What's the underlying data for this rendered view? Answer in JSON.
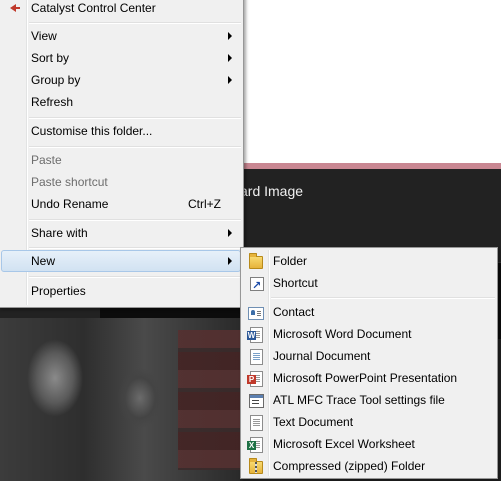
{
  "background": {
    "caption": "ard Image"
  },
  "context_menu": {
    "items": {
      "catalyst": "Catalyst Control Center",
      "view": "View",
      "sort_by": "Sort by",
      "group_by": "Group by",
      "refresh": "Refresh",
      "customise": "Customise this folder...",
      "paste": "Paste",
      "paste_shortcut": "Paste shortcut",
      "undo_rename": "Undo Rename",
      "undo_rename_shortcut": "Ctrl+Z",
      "share_with": "Share with",
      "new": "New",
      "properties": "Properties"
    }
  },
  "new_submenu": {
    "items": {
      "folder": "Folder",
      "shortcut": "Shortcut",
      "contact": "Contact",
      "word_doc": "Microsoft Word Document",
      "journal_doc": "Journal Document",
      "ppt": "Microsoft PowerPoint Presentation",
      "atl_mfc": "ATL MFC Trace Tool settings file",
      "text_doc": "Text Document",
      "excel": "Microsoft Excel Worksheet",
      "zip_folder": "Compressed (zipped) Folder"
    }
  },
  "icons": {
    "catalyst": "catalyst-icon",
    "folder": "folder-icon",
    "shortcut": "shortcut-icon",
    "contact": "contact-icon",
    "word": "word-document-icon",
    "journal": "journal-document-icon",
    "ppt": "powerpoint-icon",
    "atl": "atl-settings-icon",
    "text": "text-document-icon",
    "excel": "excel-icon",
    "zip": "zip-folder-icon"
  },
  "colors": {
    "menu_bg": "#f0f0f0",
    "menu_border": "#979797",
    "highlight_top": "#e7f0f9",
    "highlight_bottom": "#d1e2f2",
    "highlight_border": "#a8c7e8",
    "disabled_text": "#6d6d6d",
    "strip": "#c98792",
    "dark_bg": "#222222"
  }
}
